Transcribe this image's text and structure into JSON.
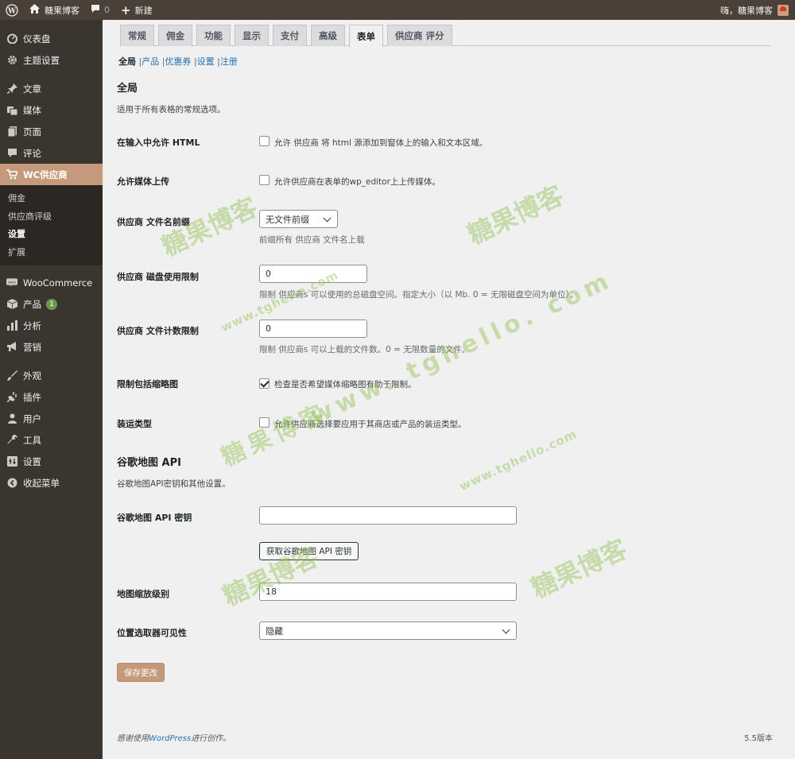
{
  "adminbar": {
    "site_name": "糖果博客",
    "comments_count": "0",
    "new_label": "新建",
    "greeting": "嗨，糖果博客"
  },
  "sidebar": {
    "items": [
      {
        "label": "仪表盘",
        "icon": "dashboard-icon"
      },
      {
        "label": "主题设置",
        "icon": "gear-icon"
      },
      {
        "label": "文章",
        "icon": "pin-icon"
      },
      {
        "label": "媒体",
        "icon": "media-icon"
      },
      {
        "label": "页面",
        "icon": "page-icon"
      },
      {
        "label": "评论",
        "icon": "comment-icon"
      },
      {
        "label": "WC供应商",
        "icon": "cart-icon"
      }
    ],
    "submenu": [
      "佣金",
      "供应商评级",
      "设置",
      "扩展"
    ],
    "items2": [
      {
        "label": "WooCommerce",
        "icon": "woo-icon"
      },
      {
        "label": "产品",
        "icon": "box-icon",
        "badge": "1"
      },
      {
        "label": "分析",
        "icon": "chart-icon"
      },
      {
        "label": "营销",
        "icon": "megaphone-icon"
      }
    ],
    "items3": [
      {
        "label": "外观",
        "icon": "brush-icon"
      },
      {
        "label": "插件",
        "icon": "plugin-icon"
      },
      {
        "label": "用户",
        "icon": "user-icon"
      },
      {
        "label": "工具",
        "icon": "wrench-icon"
      },
      {
        "label": "设置",
        "icon": "settings-icon"
      },
      {
        "label": "收起菜单",
        "icon": "collapse-icon"
      }
    ]
  },
  "tabs": [
    "常规",
    "佣金",
    "功能",
    "显示",
    "支付",
    "高级",
    "表单",
    "供应商 评分"
  ],
  "subnav": {
    "items": [
      "全局",
      "产品",
      "优惠券",
      "设置",
      "注册"
    ],
    "sep": "|"
  },
  "section1": {
    "title": "全局",
    "desc": "适用于所有表格的常规选项。"
  },
  "fields": {
    "allow_html": {
      "label": "在输入中允许 HTML",
      "checkbox_label": "允许 供应商 将 html 源添加到窗体上的输入和文本区域。"
    },
    "allow_media": {
      "label": "允许媒体上传",
      "checkbox_label": "允许供应商在表单的wp_editor上上传媒体。"
    },
    "file_prefix": {
      "label": "供应商 文件名前缀",
      "value": "无文件前缀",
      "desc": "前缀所有 供应商 文件名上载"
    },
    "disk_limit": {
      "label": "供应商 磁盘使用限制",
      "value": "0",
      "desc": "限制 供应商s 可以使用的总磁盘空间。指定大小（以 Mb. 0 = 无限磁盘空间为单位）。"
    },
    "file_count": {
      "label": "供应商 文件计数限制",
      "value": "0",
      "desc": "限制 供应商s 可以上载的文件数。0 = 无限数量的文件。"
    },
    "thumbnails": {
      "label": "限制包括缩略图",
      "checkbox_label": "检查是否希望媒体缩略图有助于限制。"
    },
    "shipping": {
      "label": "装运类型",
      "checkbox_label": "允许供应商选择要应用于其商店或产品的装运类型。"
    }
  },
  "section2": {
    "title": "谷歌地图 API",
    "desc": "谷歌地图API密钥和其他设置。"
  },
  "maps": {
    "api_key": {
      "label": "谷歌地图 API 密钥",
      "value": "",
      "button": "获取谷歌地图 API 密钥"
    },
    "zoom": {
      "label": "地图缩放级别",
      "value": "18"
    },
    "picker": {
      "label": "位置选取器可见性",
      "value": "隐藏"
    }
  },
  "save_button": "保存更改",
  "footer": {
    "prefix": "感谢使用",
    "link": "WordPress",
    "suffix": "进行创作。",
    "version": "5.5版本"
  },
  "watermarks": {
    "brand": "糖果博客",
    "url": "www.tghello.com",
    "url_spaced": "www. tghello. com"
  }
}
